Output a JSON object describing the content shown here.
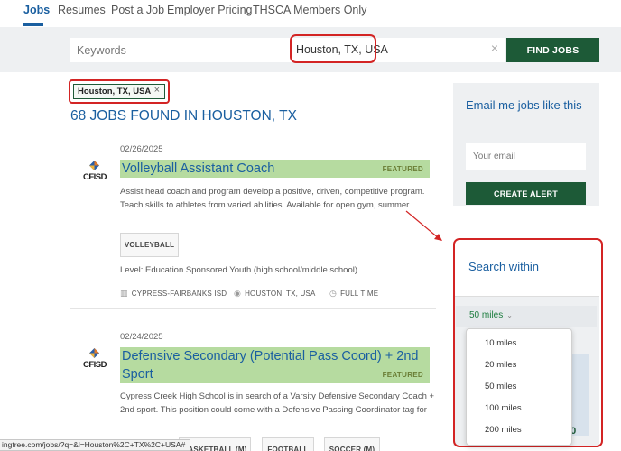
{
  "nav": {
    "items": [
      "Jobs",
      "Resumes",
      "Post a Job",
      "Employer Pricing",
      "THSCA Members Only"
    ],
    "active": "Jobs"
  },
  "search": {
    "keywords_placeholder": "Keywords",
    "location_value": "Houston, TX, USA",
    "clear_icon": "×",
    "find_label": "FIND JOBS"
  },
  "filter_chip": {
    "label": "Houston, TX, USA",
    "remove_icon": "×"
  },
  "results_heading": "68 JOBS FOUND IN HOUSTON, TX",
  "jobs": [
    {
      "date": "02/26/2025",
      "logo_text": "CFISD",
      "title": "Volleyball Assistant Coach",
      "featured": "FEATURED",
      "description": "Assist head coach and program develop a positive, driven, competitive program. Teach skills to athletes from varied abilities. Available for open gym, summer",
      "tags": [
        "VOLLEYBALL"
      ],
      "level": "Level:  Education Sponsored Youth (high school/middle school)",
      "employer": "CYPRESS-FAIRBANKS ISD",
      "location": "HOUSTON, TX, USA",
      "job_type": "FULL TIME"
    },
    {
      "date": "02/24/2025",
      "logo_text": "CFISD",
      "title_line1": "Defensive Secondary (Potential Pass Coord) + 2nd",
      "title_line2": "Sport",
      "featured": "FEATURED",
      "description": "Cypress Creek High School is in search of a Varsity Defensive Secondary Coach + 2nd sport.  This position could come with a Defensive Passing Coordinator tag for",
      "tags": [
        "BASKETBALL (M)",
        "FOOTBALL",
        "SOCCER (M)"
      ]
    }
  ],
  "sidebar": {
    "email_heading": "Email me jobs like this",
    "email_placeholder": "Your email",
    "create_alert_label": "CREATE ALERT",
    "search_within_heading": "Search within",
    "selected_radius": "50 miles",
    "radius_options": [
      "10 miles",
      "20 miles",
      "50 miles",
      "100 miles",
      "200 miles"
    ],
    "partial_text": "30"
  },
  "status_url": "ingtree.com/jobs/?q=&l=Houston%2C+TX%2C+USA#",
  "colors": {
    "brand_blue": "#1a5fa0",
    "brand_green": "#1d5a37",
    "featured_highlight": "#b6dba0",
    "annotation_red": "#d32424"
  }
}
